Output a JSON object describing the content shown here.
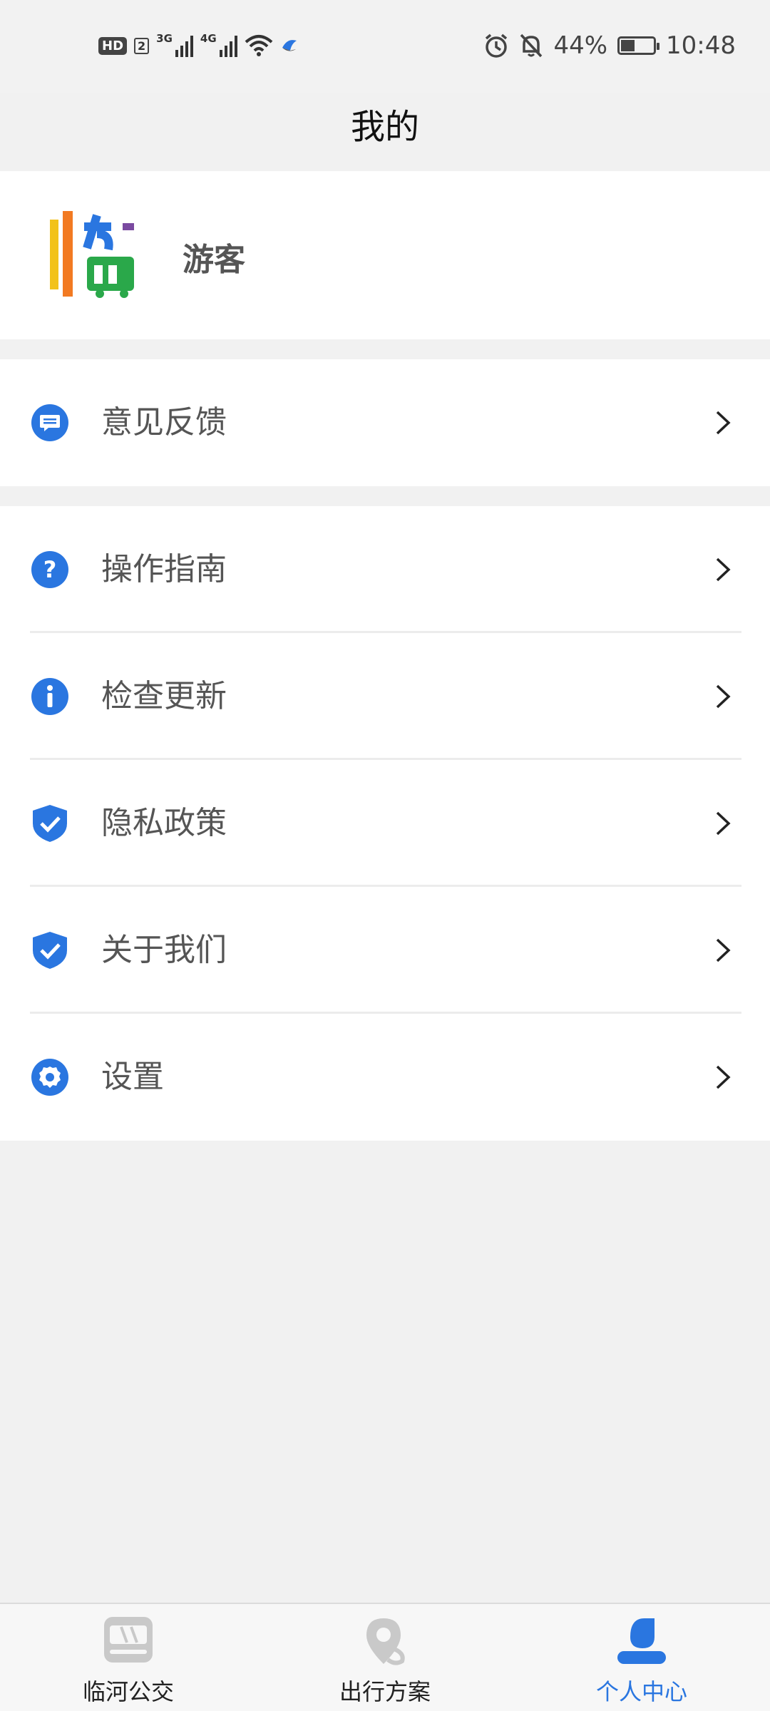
{
  "status_bar": {
    "hd": "HD",
    "sim": "2",
    "net1": "3G",
    "net2": "4G",
    "battery_percent": "44%",
    "battery_level": 0.44,
    "time": "10:48"
  },
  "header": {
    "title": "我的"
  },
  "profile": {
    "name": "游客",
    "logo_char": "临"
  },
  "menu": {
    "group1": [
      {
        "label": "意见反馈",
        "icon": "feedback-icon"
      }
    ],
    "group2": [
      {
        "label": "操作指南",
        "icon": "help-icon"
      },
      {
        "label": "检查更新",
        "icon": "info-icon"
      },
      {
        "label": "隐私政策",
        "icon": "shield-check-icon"
      },
      {
        "label": "关于我们",
        "icon": "shield-check-icon"
      },
      {
        "label": "设置",
        "icon": "gear-icon"
      }
    ]
  },
  "bottom_nav": {
    "items": [
      {
        "label": "临河公交",
        "icon": "bus-icon",
        "active": false
      },
      {
        "label": "出行方案",
        "icon": "location-pin-icon",
        "active": false
      },
      {
        "label": "个人中心",
        "icon": "person-icon",
        "active": true
      }
    ]
  },
  "colors": {
    "accent": "#2a76e0",
    "inactive_icon": "#c9c9c9",
    "background": "#f1f1f1"
  }
}
